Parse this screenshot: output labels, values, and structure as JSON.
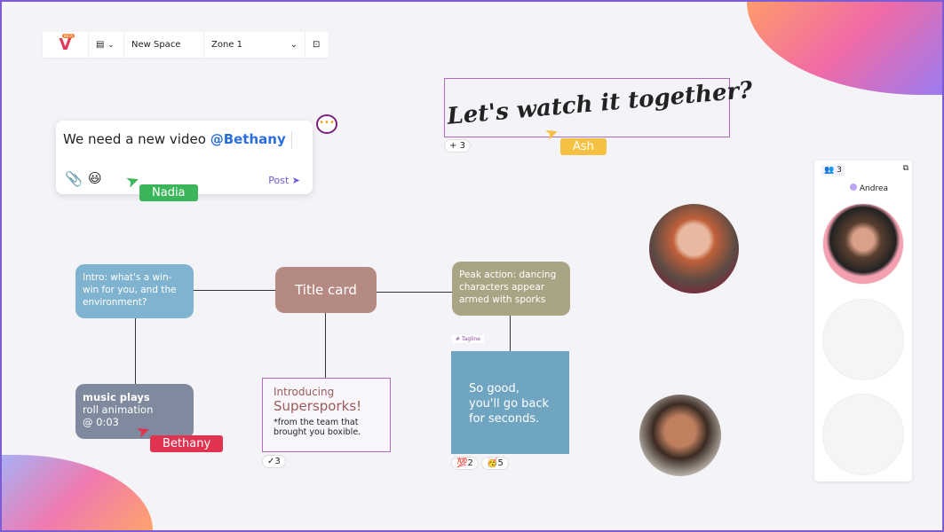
{
  "toolbar": {
    "logo_badge": "BETA",
    "space_name": "New Space",
    "zone": "Zone 1"
  },
  "comment": {
    "text": "We need a new video ",
    "mention": "@Bethany",
    "post_label": "Post",
    "emoji": "😃"
  },
  "cursors": {
    "nadia": "Nadia",
    "ash": "Ash",
    "bethany": "Bethany"
  },
  "handwritten": {
    "text": "Let's watch it together?",
    "reaction_count": "3"
  },
  "flow": {
    "intro": "Intro: what's a win-win for you, and the environment?",
    "title_card": "Title card",
    "peak": "Peak action: dancing characters appear armed with sporks",
    "music_l1": "music plays",
    "music_l2": "roll animation",
    "music_l3": "@ 0:03",
    "intro_heading": "Introducing",
    "intro_brand": "Supersporks!",
    "intro_sub": "*from the team that brought you boxible.",
    "intro_reaction": "3",
    "tag": "Tagline",
    "tagline": "So good, you'll go back for seconds.",
    "reactions": [
      {
        "emoji": "💯",
        "count": "2"
      },
      {
        "emoji": "🥳",
        "count": "5"
      }
    ]
  },
  "panel": {
    "participants": "3",
    "presenter": "Andrea"
  },
  "colors": {
    "intro": "#7fb3cf",
    "title": "#b58a82",
    "peak": "#a9a483",
    "music": "#7f8a9e",
    "tagline": "#6fa5c1",
    "selection": "#b06ac0"
  }
}
